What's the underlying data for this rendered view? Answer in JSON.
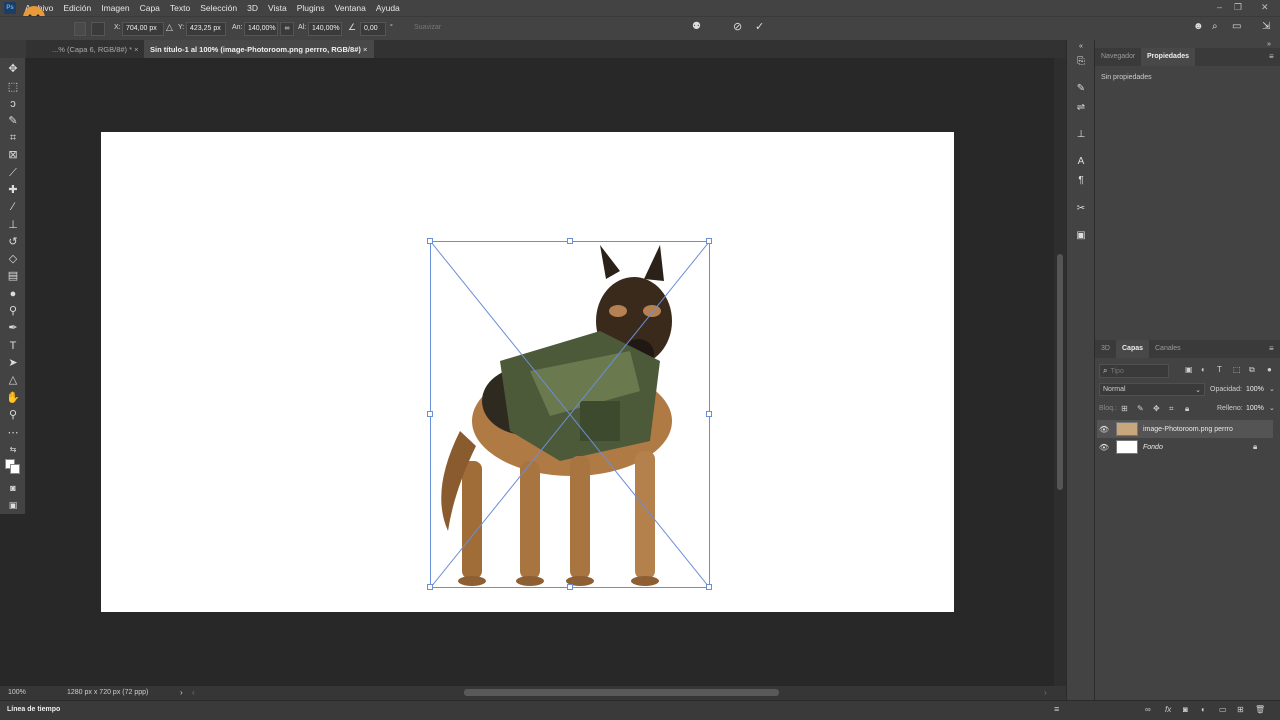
{
  "menu": {
    "logo": "Ps",
    "items": [
      "Archivo",
      "Edición",
      "Imagen",
      "Capa",
      "Texto",
      "Selección",
      "3D",
      "Vista",
      "Plugins",
      "Ventana",
      "Ayuda"
    ]
  },
  "options": {
    "x_label": "X:",
    "x_value": "704,00 px",
    "y_label": "Y:",
    "y_value": "423,25 px",
    "w_label": "An:",
    "w_value": "140,00%",
    "h_label": "Al:",
    "h_value": "140,00%",
    "angle_value": "0,00",
    "angle_unit": "°",
    "interp": "Suavizar",
    "link_symbol": "∞"
  },
  "tabs": [
    {
      "label": "...% (Capa 6, RGB/8#) *",
      "active": false
    },
    {
      "label": "Sin título-1 al 100% (image-Photoroom.png perrro, RGB/8#)",
      "active": true
    }
  ],
  "status": {
    "zoom": "100%",
    "doc_size": "1280 px x 720 px (72 ppp)"
  },
  "timeline": {
    "label": "Línea de tiempo"
  },
  "properties_panel": {
    "tabs": [
      "Navegador",
      "Propiedades"
    ],
    "active_tab": "Propiedades",
    "empty_text": "Sin propiedades"
  },
  "layers_panel": {
    "tabs": [
      "3D",
      "Capas",
      "Canales"
    ],
    "active_tab": "Capas",
    "search_placeholder": "Tipo",
    "blend_mode": "Normal",
    "opacity_label": "Opacidad:",
    "opacity_value": "100%",
    "lock_label": "Bloq.:",
    "fill_label": "Relleno:",
    "fill_value": "100%",
    "layers": [
      {
        "name": "image-Photoroom.png perrro",
        "selected": true
      },
      {
        "name": "Fondo",
        "selected": false,
        "locked": true
      }
    ]
  },
  "colors": {
    "accent": "#6b8ed8",
    "panel": "#434343",
    "canvas_bg": "#282828"
  }
}
